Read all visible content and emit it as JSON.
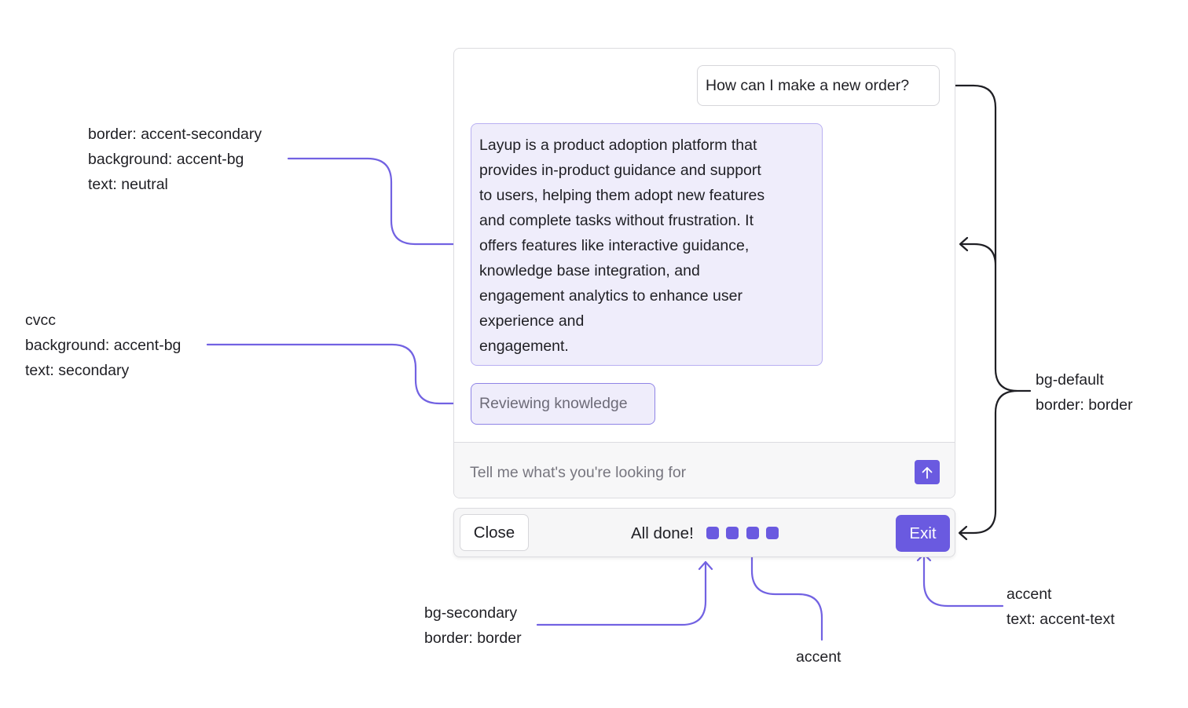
{
  "colors": {
    "accent": "#6a5ae0",
    "accent_connector": "#7262e2",
    "accent_bg": "#efedfb",
    "accent_secondary": "#b9b0f2",
    "bracket": "#1f1f24",
    "border": "#dcdce0",
    "bg_secondary": "#f6f6f7"
  },
  "chat": {
    "user_message": "How can I make a new order?",
    "answer_lines": [
      "Layup is a product adoption platform that",
      "provides in-product guidance and support",
      "to users, helping them adopt new features",
      "and complete tasks without frustration. It",
      "offers features like interactive guidance,",
      "knowledge base integration, and",
      "engagement analytics to enhance user",
      "experience and",
      "engagement."
    ],
    "status": "Reviewing knowledge",
    "input_placeholder": "Tell me what's you're looking for",
    "send_icon": "arrow-up-icon"
  },
  "footer": {
    "close_label": "Close",
    "progress_label": "All done!",
    "progress_steps": 4,
    "exit_label": "Exit"
  },
  "annotations": {
    "answer_bubble": [
      "border: accent-secondary",
      "background: accent-bg",
      "text: neutral"
    ],
    "status_bubble": [
      "cvcc",
      "background: accent-bg",
      "text: secondary"
    ],
    "panel": [
      "bg-default",
      "border: border"
    ],
    "footer_bar": [
      "bg-secondary",
      "border: border"
    ],
    "progress_dots": [
      "accent"
    ],
    "exit_button": [
      "accent",
      "text: accent-text"
    ]
  }
}
